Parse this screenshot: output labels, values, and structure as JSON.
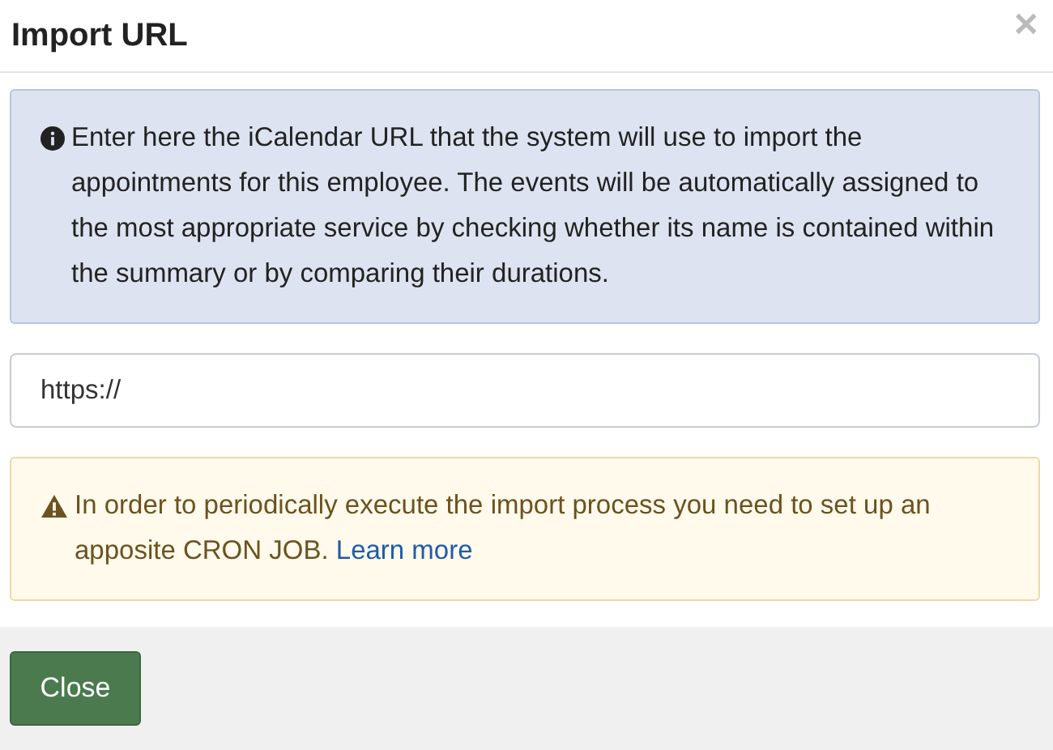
{
  "dialog": {
    "title": "Import URL",
    "close_icon": "✕"
  },
  "info": {
    "text": "Enter here the iCalendar URL that the system will use to import the appointments for this employee. The events will be automatically assigned to the most appropriate service by checking whether its name is contained within the summary or by comparing their durations."
  },
  "url_field": {
    "value": "https://"
  },
  "warning": {
    "text": "In order to periodically execute the import process you need to set up an apposite CRON JOB.",
    "link": "Learn more"
  },
  "buttons": [
    "Close"
  ]
}
